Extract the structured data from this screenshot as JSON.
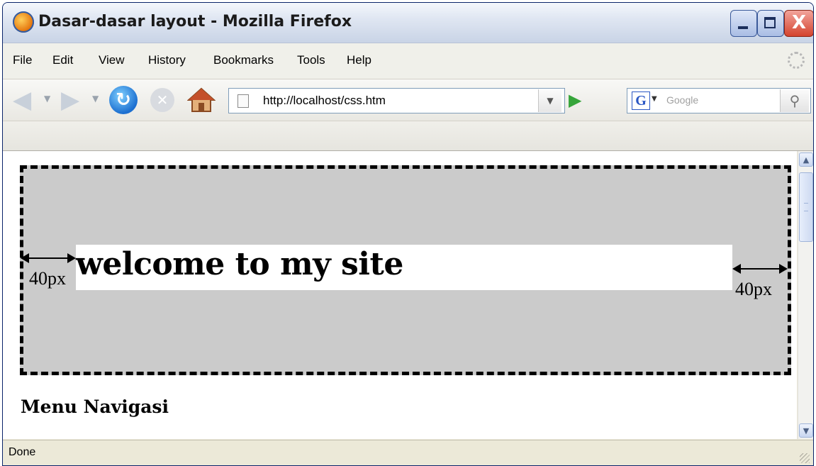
{
  "window": {
    "title": "Dasar-dasar layout - Mozilla Firefox",
    "close_glyph": "X"
  },
  "menu": {
    "items": [
      "File",
      "Edit",
      "View",
      "History",
      "Bookmarks",
      "Tools",
      "Help"
    ]
  },
  "toolbar": {
    "back_icon": "back-arrow-icon",
    "forward_icon": "forward-arrow-icon",
    "reload_icon": "reload-icon",
    "stop_icon": "stop-icon",
    "home_icon": "home-icon",
    "url": "http://localhost/css.htm",
    "search_engine": "G",
    "search_placeholder": "Google"
  },
  "page": {
    "site_title": "welcome to my site",
    "margin_left_label": "40px",
    "margin_right_label": "40px",
    "nav_heading": "Menu Navigasi"
  },
  "status": {
    "text": "Done"
  },
  "colors": {
    "header_background": "#cbcbcb",
    "heading_background": "#ffffff",
    "border": "#000000"
  }
}
